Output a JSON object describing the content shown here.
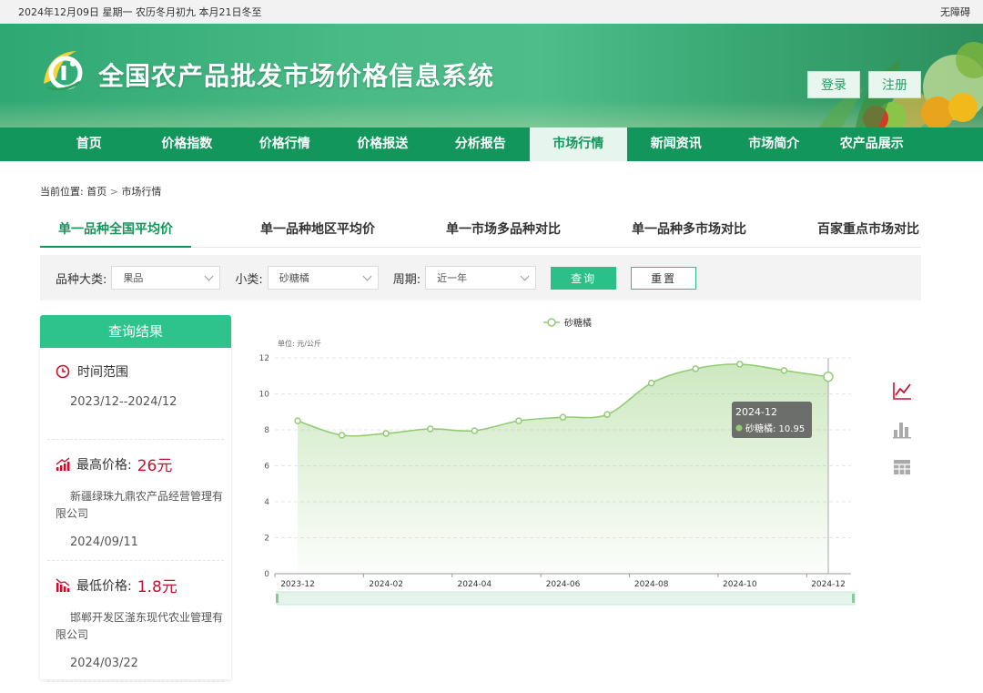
{
  "topbar": {
    "date_text": "2024年12月09日 星期一 农历冬月初九 本月21日冬至",
    "accessibility": "无障碍"
  },
  "header": {
    "title": "全国农产品批发市场价格信息系统",
    "login": "登录",
    "register": "注册"
  },
  "nav": [
    "首页",
    "价格指数",
    "价格行情",
    "价格报送",
    "分析报告",
    "市场行情",
    "新闻资讯",
    "市场简介",
    "农产品展示"
  ],
  "nav_active": "市场行情",
  "breadcrumb": {
    "prefix": "当前位置:",
    "home": "首页",
    "sep": ">",
    "current": "市场行情"
  },
  "tabs": [
    "单一品种全国平均价",
    "单一品种地区平均价",
    "单一市场多品种对比",
    "单一品种多市场对比",
    "百家重点市场对比"
  ],
  "tab_active": "单一品种全国平均价",
  "filter": {
    "category_label": "品种大类:",
    "category_value": "果品",
    "sub_label": "小类:",
    "sub_value": "砂糖橘",
    "period_label": "周期:",
    "period_value": "近一年",
    "query": "查询",
    "reset": "重置"
  },
  "result": {
    "header": "查询结果",
    "time_label": "时间范围",
    "time_value": "2023/12--2024/12",
    "max_label": "最高价格:",
    "max_value": "26元",
    "max_market": "新疆绿珠九鼎农产品经营管理有限公司",
    "max_date": "2024/09/11",
    "min_label": "最低价格:",
    "min_value": "1.8元",
    "min_market": "邯郸开发区滏东现代农业管理有限公司",
    "min_date": "2024/03/22"
  },
  "chart_data": {
    "type": "area",
    "unit_label": "单位: 元/公斤",
    "x": [
      "2023-12",
      "2024-01",
      "2024-02",
      "2024-03",
      "2024-04",
      "2024-05",
      "2024-06",
      "2024-07",
      "2024-08",
      "2024-09",
      "2024-10",
      "2024-11",
      "2024-12"
    ],
    "x_ticks": [
      "2023-12",
      "2024-02",
      "2024-04",
      "2024-06",
      "2024-08",
      "2024-10",
      "2024-12"
    ],
    "series": [
      {
        "name": "砂糖橘",
        "values": [
          8.5,
          7.7,
          7.8,
          8.05,
          7.95,
          8.5,
          8.7,
          8.85,
          10.6,
          11.4,
          11.65,
          11.3,
          10.95
        ]
      }
    ],
    "ylim": [
      0,
      12
    ],
    "y_ticks": [
      0,
      2,
      4,
      6,
      8,
      10,
      12
    ],
    "grid": true,
    "legend": "top-center",
    "color": "#91cc75",
    "tooltip": {
      "title": "2024-12",
      "label": "砂糖橘: 10.95"
    }
  },
  "colors": {
    "primary": "#12965c",
    "accent": "#2ec38d",
    "price": "#c8102e"
  }
}
